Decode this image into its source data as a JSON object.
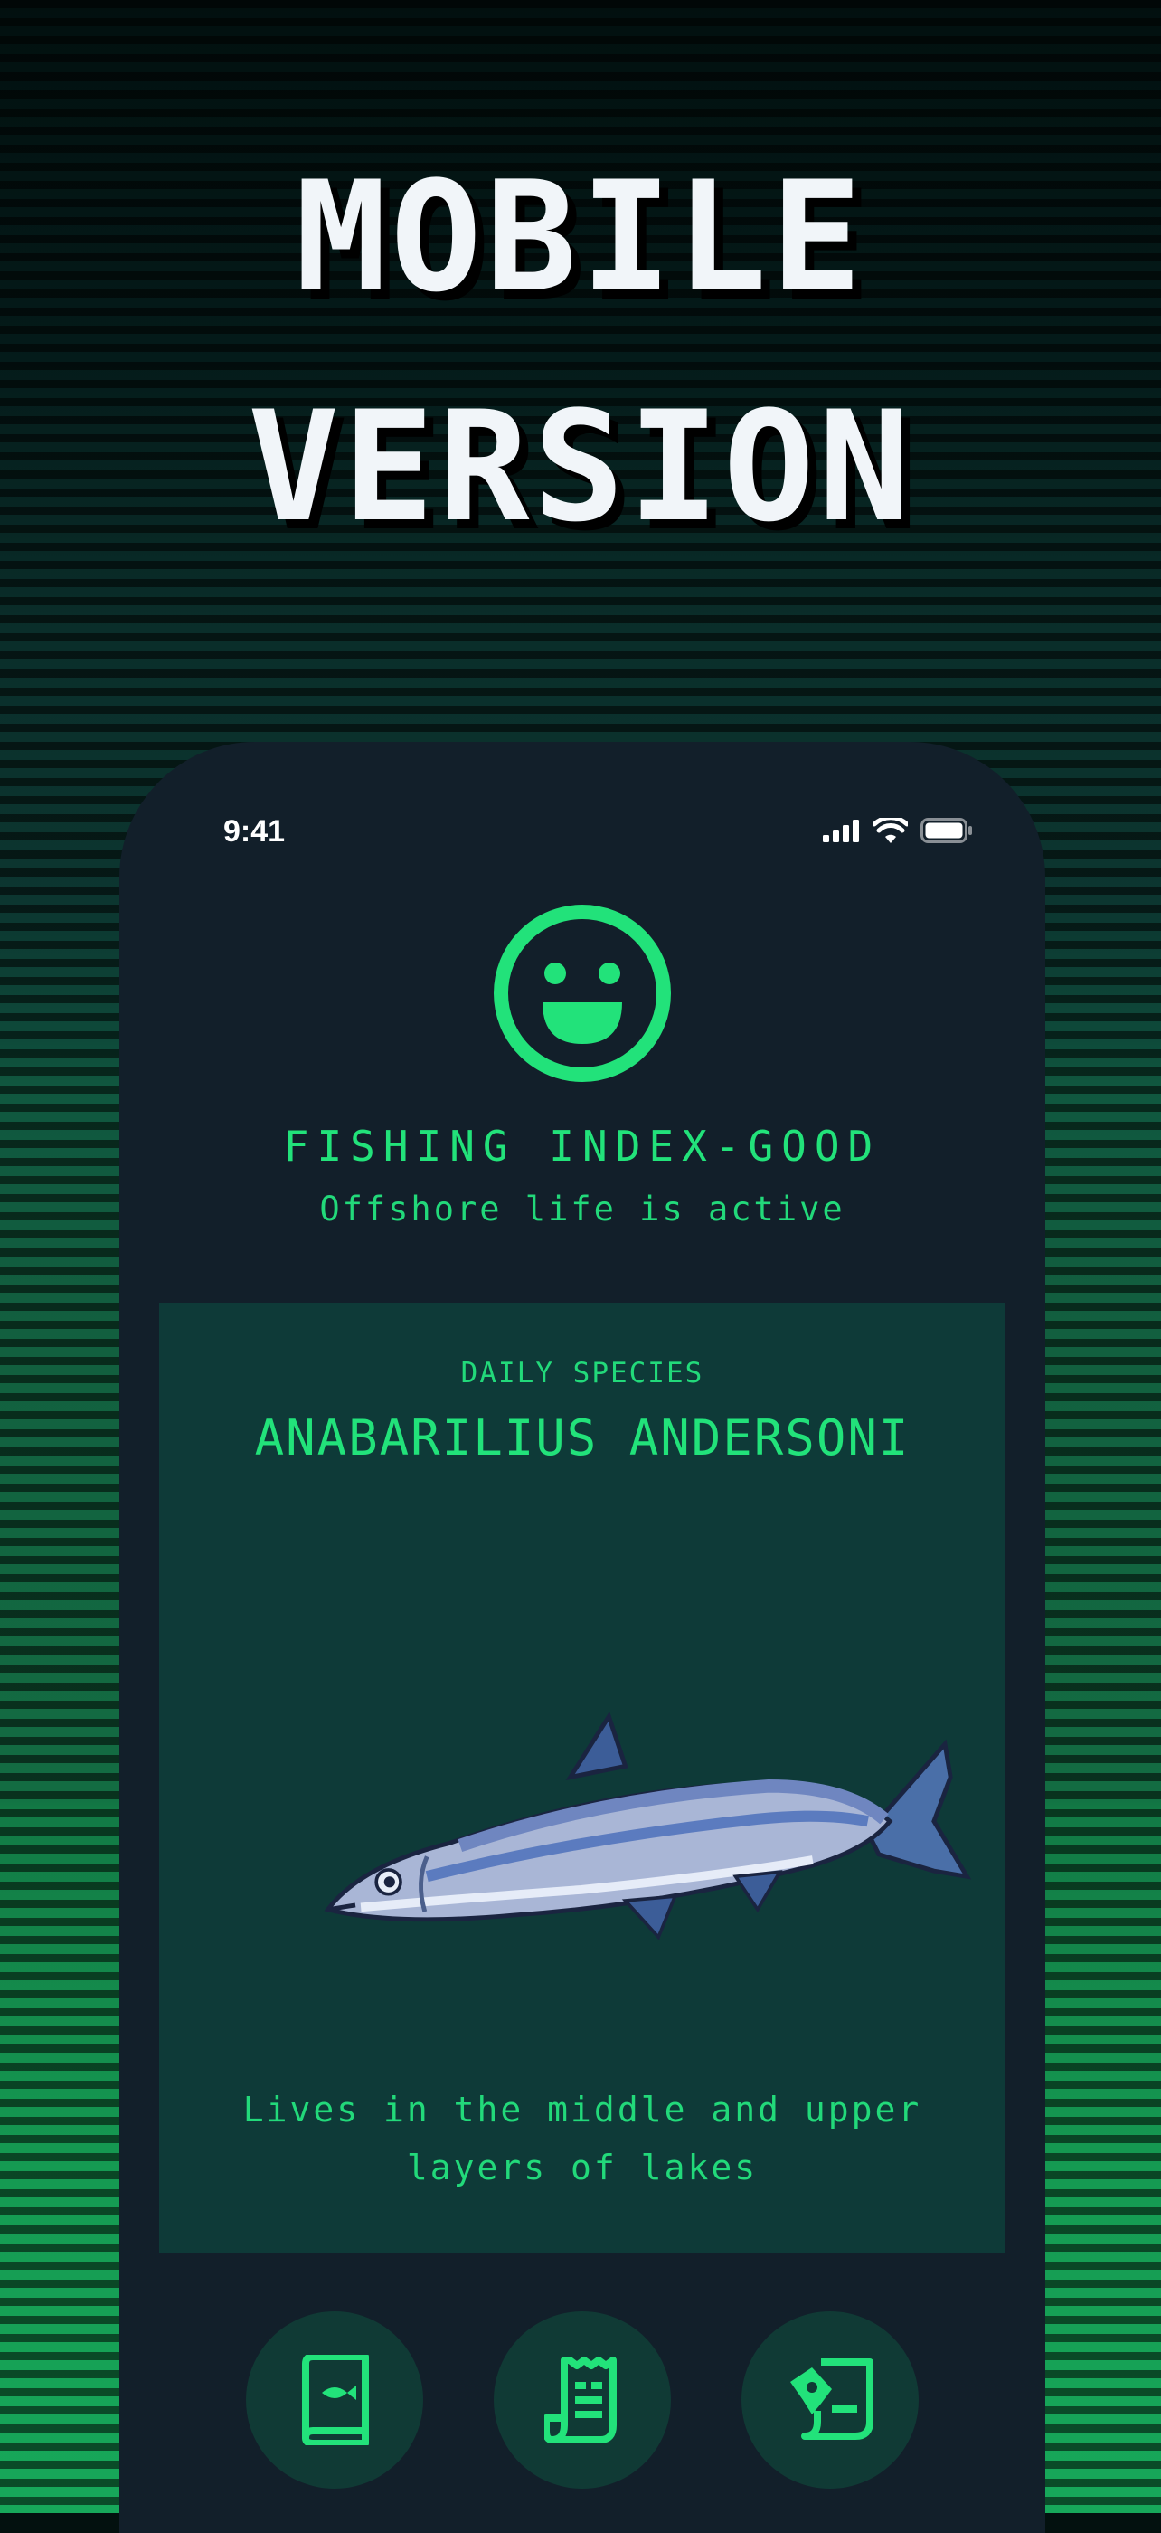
{
  "headline": {
    "line1": "MOBILE",
    "line2": "VERSION"
  },
  "status_bar": {
    "time": "9:41"
  },
  "fishing_index": {
    "title": "FISHING INDEX-GOOD",
    "subtitle": "Offshore life is active",
    "status_icon": "smiley-face-icon"
  },
  "daily_species": {
    "label": "DAILY SPECIES",
    "name": "ANABARILIUS ANDERSONI",
    "description_line1": "Lives in the middle and upper",
    "description_line2": "layers of lakes"
  },
  "bottom_nav": [
    {
      "icon": "fish-book-icon"
    },
    {
      "icon": "receipt-icon"
    },
    {
      "icon": "map-pin-icon"
    }
  ],
  "colors": {
    "accent": "#22e27a",
    "phone_background": "#121f2a",
    "card_background": "#0e3a38",
    "nav_button_background": "#103a35",
    "headline_text": "#f1f5f9"
  }
}
